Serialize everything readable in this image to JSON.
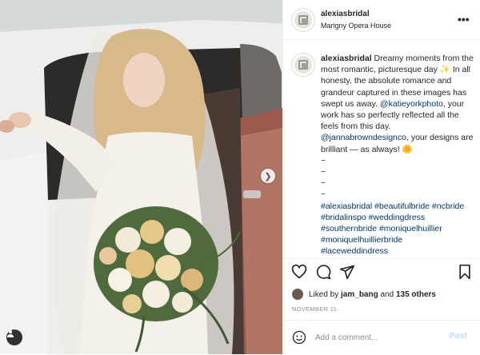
{
  "post": {
    "username": "alexiasbridal",
    "location": "Marigny Opera House"
  },
  "caption": {
    "username": "alexiasbridal",
    "part1": " Dreamy moments from the most romantic, picturesque day ",
    "emoji1": "✨",
    "part2": " In all honesty, the absolute romance and grandeur captured in these images has swept us away. ",
    "mention1": "@katieyorkphoto",
    "part3": ", your work has so perfectly reflected all the feels from this day. ",
    "mention2": "@jannabrowndesignco",
    "part4": ", your designs are brilliant — as always! ",
    "emoji2": "🌼",
    "tilde": "~",
    "tags_line1": "#alexiasbridal #beautifulbride #ncbride",
    "tags_line2": "#bridalinspo #weddingdress",
    "tags_line3": "#southernbride #moniquelhuillier",
    "tags_line4": "#moniquelhuillierbride",
    "tags_line5": "#laceweddindress"
  },
  "likes": {
    "prefix": "Liked by ",
    "user": "jam_bang",
    "middle": " and ",
    "count": "135 others"
  },
  "date": "NOVEMBER 11",
  "comment": {
    "placeholder": "Add a comment...",
    "post_label": "Post"
  },
  "icons": {
    "more": "more-options-icon",
    "like": "heart-icon",
    "comment": "comment-icon",
    "share": "share-icon",
    "save": "bookmark-icon",
    "emoji": "emoji-icon",
    "next": "chevron-right-icon",
    "tags": "user-tag-icon"
  },
  "colors": {
    "link": "#00376b",
    "post_disabled": "#b2dffc",
    "muted": "#8e8e8e",
    "border": "#efefef"
  }
}
